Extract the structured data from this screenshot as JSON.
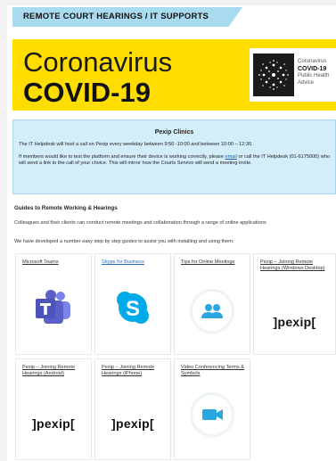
{
  "header": {
    "title": "REMOTE COURT HEARINGS / IT SUPPORTS"
  },
  "banner": {
    "line1": "Coronavirus",
    "line2": "COVID-19",
    "logo_lines": [
      "Coronavirus",
      "COVID-19",
      "Public Health",
      "Advice"
    ],
    "background": "#ffdd00"
  },
  "clinic": {
    "title": "Pexip Clinics",
    "para1": "The IT Helpdesk will host a call on Pexip every weekday between 9:50 -10:00 and between 10:00 – 12:30.",
    "para2_before": "If members would like to test the platform and ensure their device is working correctly, please ",
    "para2_link": "email",
    "para2_after": " or call the IT Helpdesk (01-6175000) who will send a link to the call of your choice. This will mirror how the Courts Service will send a meeting invite.",
    "background": "#d3edf9"
  },
  "guides": {
    "heading": "Guides to Remote Working & Hearings",
    "para1": "Colleagues and their clients can conduct remote meetings and collaboration through a range of online applications",
    "para2": "We have developed a number easy step by step guides to assist you with installing and using them:"
  },
  "cards": [
    {
      "title": "Microsoft Teams",
      "icon": "teams-icon"
    },
    {
      "title": "Skype for Business",
      "icon": "skype-icon"
    },
    {
      "title": "Tips for Online Meetings",
      "icon": "people-icon"
    },
    {
      "title": "Pexip – Joining Remote Hearings (Windows Desktop)",
      "icon": "pexip-logo",
      "logo_text": "]pexip["
    },
    {
      "title": "Pexip – Joining Remote Hearings (Android)",
      "icon": "pexip-logo",
      "logo_text": "]pexip["
    },
    {
      "title": "Pexip – Joining Remote Hearings (iPhone)",
      "icon": "pexip-logo",
      "logo_text": "]pexip["
    },
    {
      "title": "Video Conferencing Terms & Symbols",
      "icon": "video-camera-icon"
    }
  ],
  "colors": {
    "accent_blue": "#a9dbf0",
    "teams_purple": "#5b5fc7",
    "skype_blue": "#00a9e8",
    "icon_blue": "#2aa7e0"
  }
}
